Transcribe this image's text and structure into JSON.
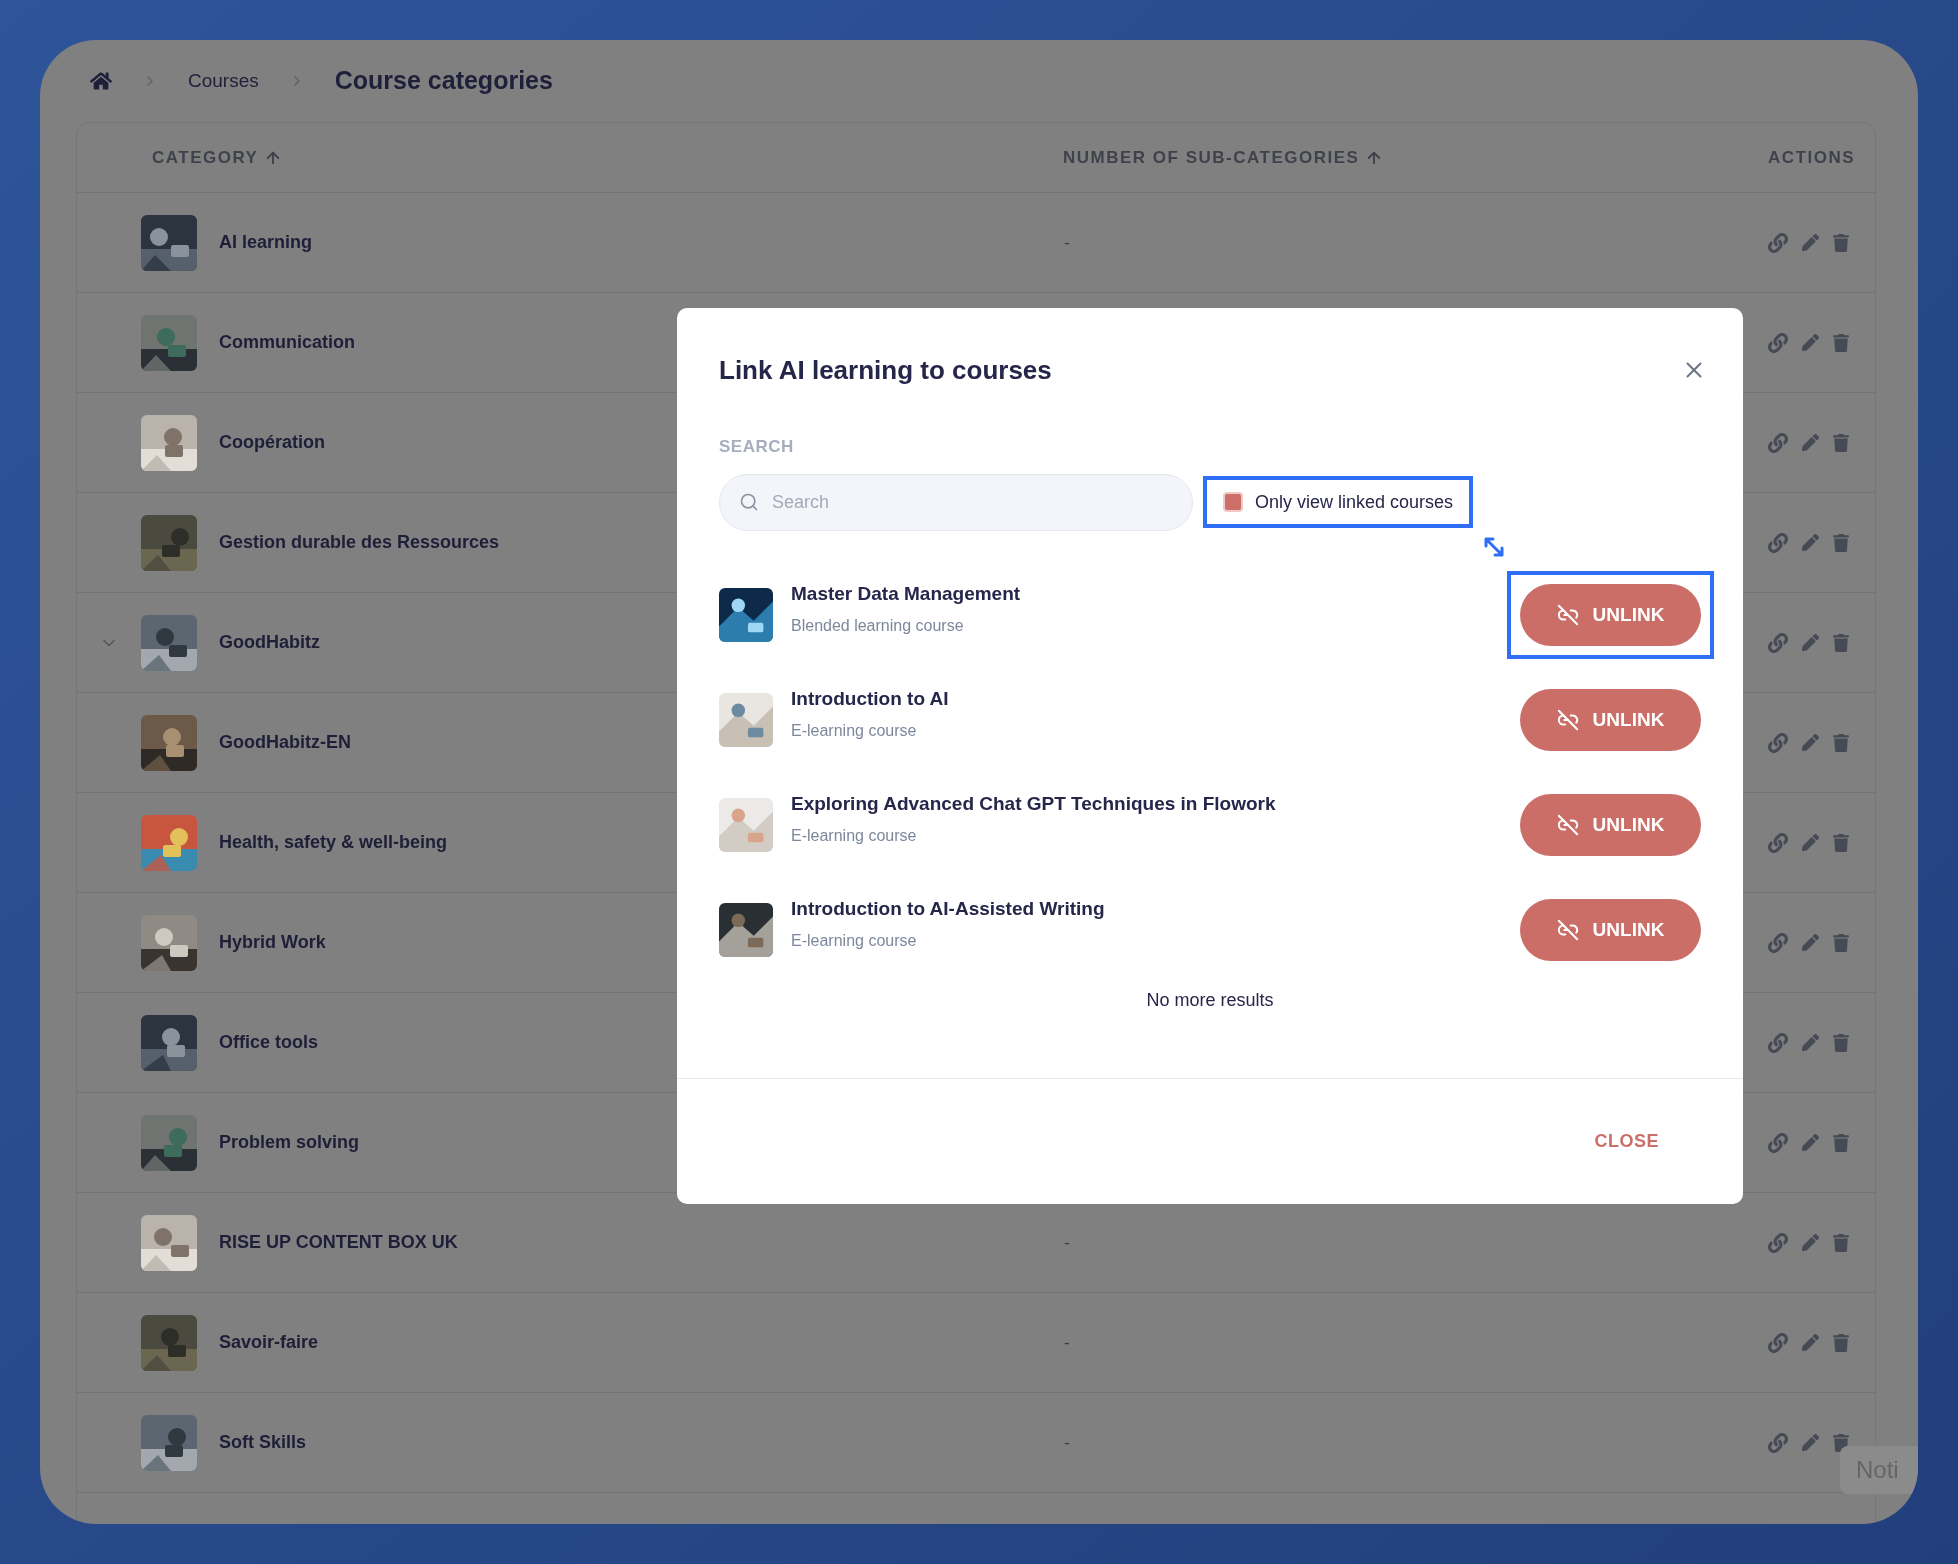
{
  "breadcrumb": {
    "items": [
      {
        "label": "Courses"
      }
    ],
    "current": "Course categories"
  },
  "table": {
    "columns": [
      {
        "label": "CATEGORY",
        "sortable": true
      },
      {
        "label": "NUMBER OF SUB-CATEGORIES",
        "sortable": true
      },
      {
        "label": "ACTIONS",
        "sortable": false
      }
    ],
    "rows": [
      {
        "name": "AI learning",
        "sub_categories": "-",
        "expandable": false
      },
      {
        "name": "Communication",
        "expandable": false
      },
      {
        "name": "Coopération",
        "expandable": false
      },
      {
        "name": "Gestion durable des Ressources",
        "expandable": false
      },
      {
        "name": "GoodHabitz",
        "expandable": true
      },
      {
        "name": "GoodHabitz-EN",
        "expandable": false
      },
      {
        "name": "Health, safety & well-being",
        "expandable": false
      },
      {
        "name": "Hybrid Work",
        "expandable": false
      },
      {
        "name": "Office tools",
        "expandable": false
      },
      {
        "name": "Problem solving",
        "expandable": false
      },
      {
        "name": "RISE UP CONTENT BOX UK",
        "sub_categories": "-",
        "expandable": false
      },
      {
        "name": "Savoir-faire",
        "sub_categories": "-",
        "expandable": false
      },
      {
        "name": "Soft Skills",
        "sub_categories": "-",
        "expandable": false
      }
    ]
  },
  "dialog": {
    "title": "Link AI learning to courses",
    "search_label": "SEARCH",
    "search": {
      "placeholder": "Search"
    },
    "filter": {
      "label": "Only view linked courses",
      "checked": true,
      "highlighted": true
    },
    "courses": [
      {
        "title": "Master Data Management",
        "type": "Blended learning course",
        "action": "UNLINK",
        "highlighted": true
      },
      {
        "title": "Introduction to AI",
        "type": "E-learning course",
        "action": "UNLINK",
        "highlighted": false
      },
      {
        "title": "Exploring Advanced Chat GPT Techniques in Flowork",
        "type": "E-learning course",
        "action": "UNLINK",
        "highlighted": false
      },
      {
        "title": "Introduction to AI-Assisted Writing",
        "type": "E-learning course",
        "action": "UNLINK",
        "highlighted": false
      }
    ],
    "end_note": "No more results",
    "close_button": "CLOSE"
  },
  "toast": {
    "text": "Noti"
  }
}
